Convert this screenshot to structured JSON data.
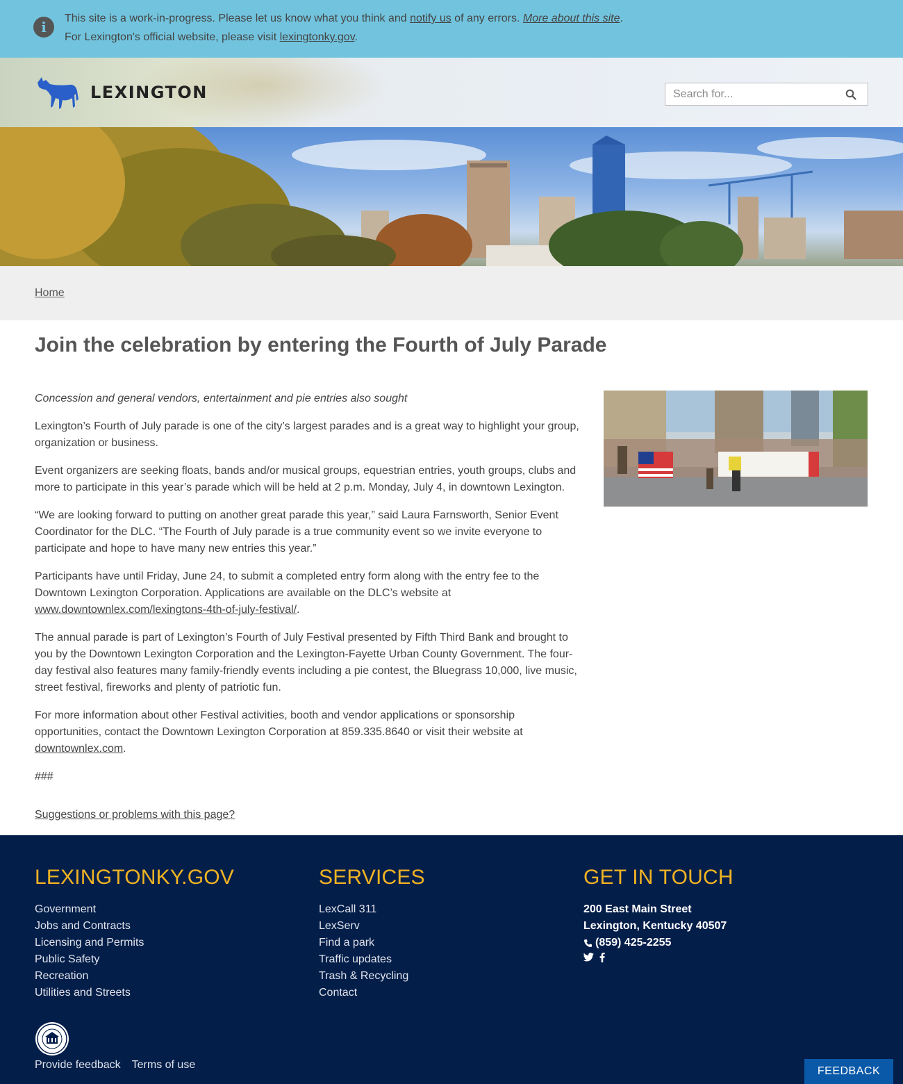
{
  "alert": {
    "line1_prefix": "This site is a work-in-progress. Please let us know what you think and",
    "line1_link": "notify us",
    "line1_middle": "of any errors.",
    "line1_more": "More about this site",
    "line1_suffix": ".",
    "line2_prefix": "For Lexington's official website, please visit",
    "line2_link": "lexingtonky.gov",
    "line2_suffix": ".",
    "icon": "info-icon"
  },
  "header": {
    "logo_text": "LEXINGTON",
    "logo_icon": "horse-icon",
    "search_placeholder": "Search for...",
    "brand_color": "#2a5fc9"
  },
  "breadcrumb": {
    "home": "Home"
  },
  "main": {
    "title": "Join the celebration by entering the Fourth of July Parade",
    "lede": "Concession and general vendors, entertainment and pie entries also sought",
    "p1": "Lexington’s Fourth of July parade is one of the city’s largest parades and is a great way to highlight your group, organization or business.",
    "p2": "Event organizers are seeking floats, bands and/or musical groups, equestrian entries, youth groups, clubs and more to participate in this year’s parade which will be held at 2 p.m. Monday, July 4, in downtown Lexington.",
    "p3": "“We are looking forward to putting on another great parade this year,” said Laura Farnsworth, Senior Event Coordinator for the DLC. “The Fourth of July parade is a true community event so we invite everyone to participate and hope to have many new entries this year.”",
    "p4_text": "Participants have until Friday, June 24, to submit a completed entry form along with the entry fee to the Downtown Lexington Corporation. Applications are available on the DLC’s website at",
    "p4_link": "www.downtownlex.com/lexingtons-4th-of-july-festival/",
    "p4_end": ".",
    "p5": "The annual parade is part of Lexington’s Fourth of July Festival presented by Fifth Third Bank and brought to you by the Downtown Lexington Corporation and the Lexington-Fayette Urban County Government. The four-day festival also features many family-friendly events including a pie contest, the Bluegrass 10,000, live music, street festival, fireworks and plenty of patriotic fun.",
    "p6_text": "For more information about other Festival activities, booth and vendor applications or sponsorship opportunities, contact the Downtown Lexington Corporation at 859.335.8640 or visit their website at",
    "p6_link": "downtownlex.com",
    "p6_end": ".",
    "p7": "###",
    "suggest": "Suggestions or problems with this page?"
  },
  "footer": {
    "col1": {
      "heading": "LEXINGTONKY.GOV",
      "items": [
        "Government",
        "Jobs and Contracts",
        "Licensing and Permits",
        "Public Safety",
        "Recreation",
        "Utilities and Streets"
      ]
    },
    "col2": {
      "heading": "SERVICES",
      "items": [
        "LexCall 311",
        "LexServ",
        "Find a park",
        "Traffic updates",
        "Trash & Recycling",
        "Contact"
      ]
    },
    "col3": {
      "heading": "GET IN TOUCH",
      "address1": "200 East Main Street",
      "address2": "Lexington, Kentucky 40507",
      "phone": "(859) 425-2255"
    },
    "provide_feedback": "Provide feedback",
    "terms": "Terms of use",
    "feedback_button": "FEEDBACK",
    "bg_color": "#041e4a",
    "heading_color": "#f0b323"
  }
}
